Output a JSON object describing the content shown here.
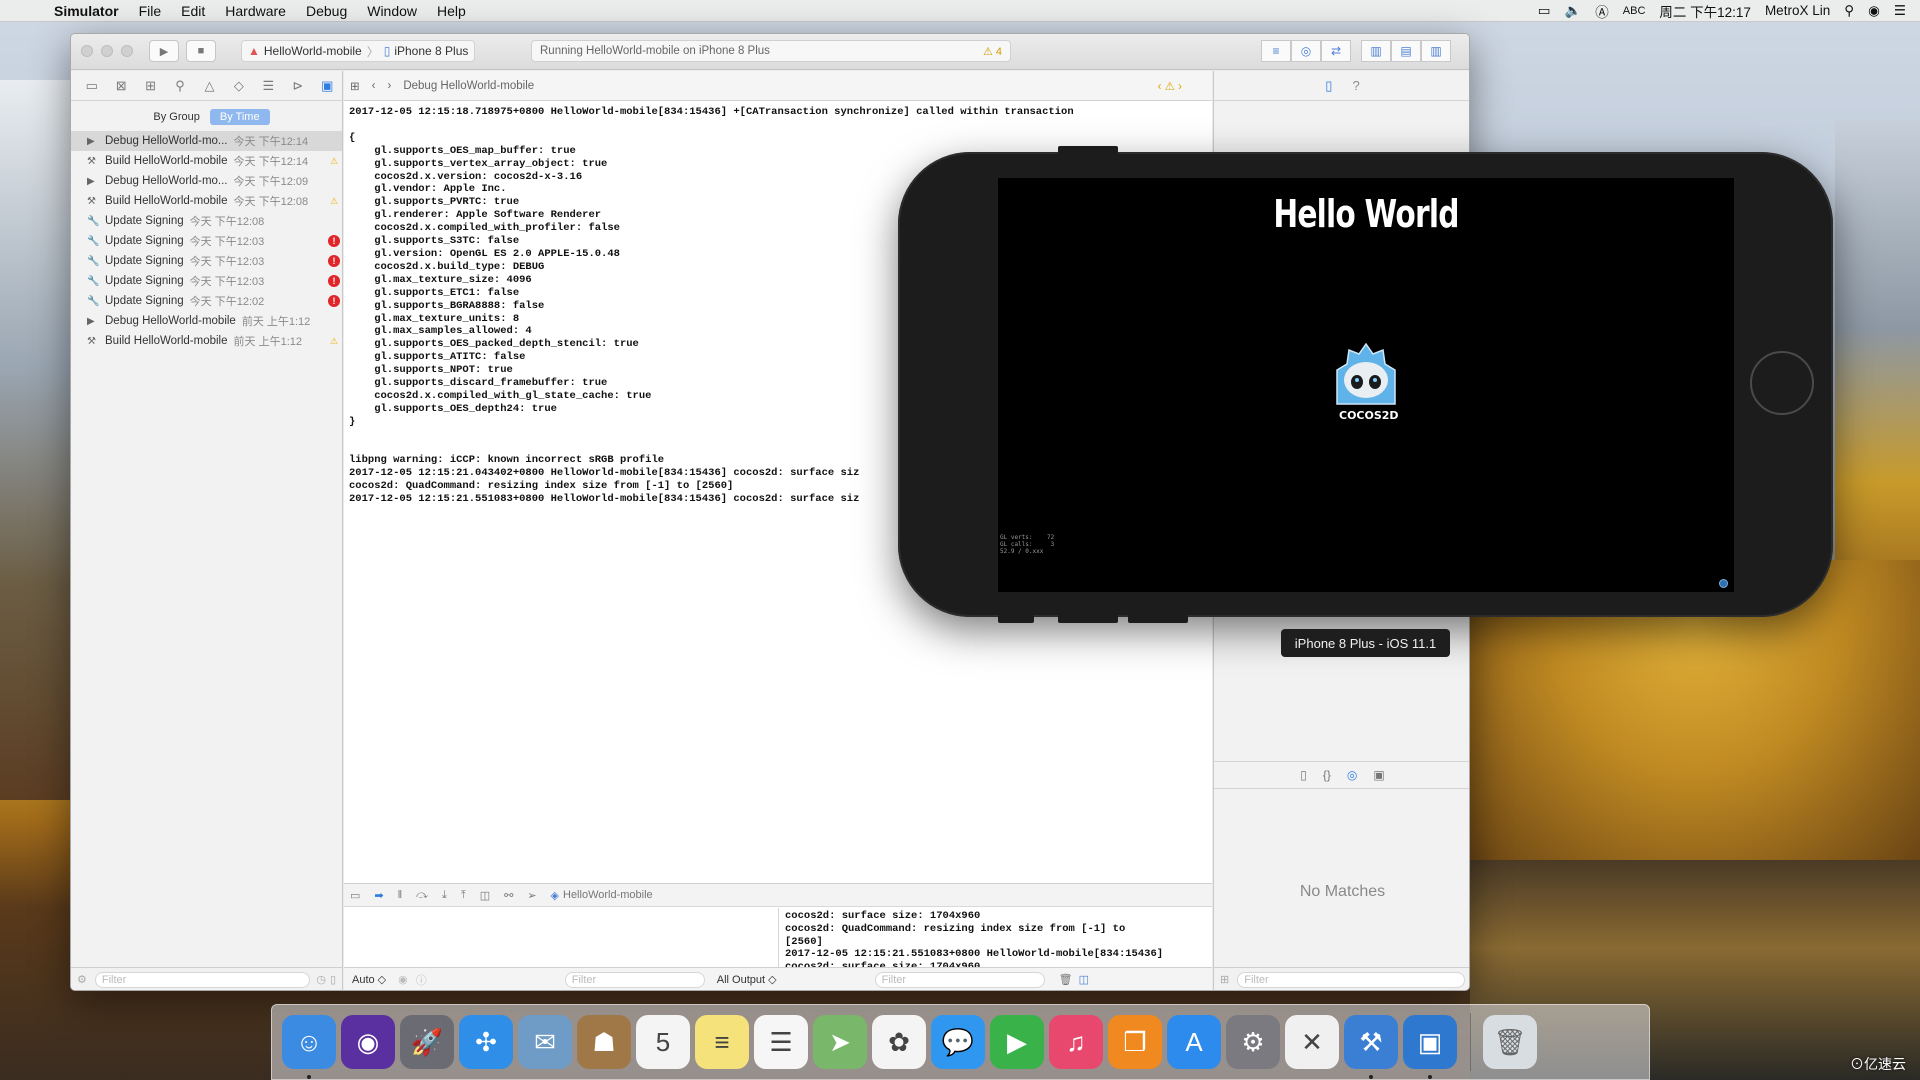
{
  "menubar": {
    "app": "Simulator",
    "items": [
      "File",
      "Edit",
      "Hardware",
      "Debug",
      "Window",
      "Help"
    ],
    "input_source": "ABC",
    "clock": "周二 下午12:17",
    "user": "MetroX Lin"
  },
  "toolbar": {
    "scheme": "HelloWorld-mobile",
    "device": "iPhone 8 Plus",
    "activity": "Running HelloWorld-mobile on iPhone 8 Plus",
    "warning_count": "4"
  },
  "navigator": {
    "group_by": [
      "By Group",
      "By Time"
    ],
    "reports": [
      {
        "label": "Debug HelloWorld-mo...",
        "time": "今天 下午12:14",
        "badge": "",
        "icon": "play-icon"
      },
      {
        "label": "Build HelloWorld-mobile",
        "time": "今天 下午12:14",
        "badge": "warn",
        "icon": "hammer-icon"
      },
      {
        "label": "Debug HelloWorld-mo...",
        "time": "今天 下午12:09",
        "badge": "",
        "icon": "play-icon"
      },
      {
        "label": "Build HelloWorld-mobile",
        "time": "今天 下午12:08",
        "badge": "warn",
        "icon": "hammer-icon"
      },
      {
        "label": "Update Signing",
        "time": "今天 下午12:08",
        "badge": "",
        "icon": "wrench-icon"
      },
      {
        "label": "Update Signing",
        "time": "今天 下午12:03",
        "badge": "err",
        "icon": "wrench-icon"
      },
      {
        "label": "Update Signing",
        "time": "今天 下午12:03",
        "badge": "err",
        "icon": "wrench-icon"
      },
      {
        "label": "Update Signing",
        "time": "今天 下午12:03",
        "badge": "err",
        "icon": "wrench-icon"
      },
      {
        "label": "Update Signing",
        "time": "今天 下午12:02",
        "badge": "err",
        "icon": "wrench-icon"
      },
      {
        "label": "Debug HelloWorld-mobile",
        "time": "前天 上午1:12",
        "badge": "",
        "icon": "play-icon"
      },
      {
        "label": "Build HelloWorld-mobile",
        "time": "前天 上午1:12",
        "badge": "warn",
        "icon": "hammer-icon"
      }
    ],
    "filter_placeholder": "Filter"
  },
  "editor": {
    "jumpbar_title": "Debug HelloWorld-mobile",
    "log_lines": [
      "2017-12-05 12:15:18.718975+0800 HelloWorld-mobile[834:15436] +[CATransaction synchronize] called within transaction",
      "",
      "{",
      "    gl.supports_OES_map_buffer: true",
      "    gl.supports_vertex_array_object: true",
      "    cocos2d.x.version: cocos2d-x-3.16",
      "    gl.vendor: Apple Inc.",
      "    gl.supports_PVRTC: true",
      "    gl.renderer: Apple Software Renderer",
      "    cocos2d.x.compiled_with_profiler: false",
      "    gl.supports_S3TC: false",
      "    gl.version: OpenGL ES 2.0 APPLE-15.0.48",
      "    cocos2d.x.build_type: DEBUG",
      "    gl.max_texture_size: 4096",
      "    gl.supports_ETC1: false",
      "    gl.supports_BGRA8888: false",
      "    gl.max_texture_units: 8",
      "    gl.max_samples_allowed: 4",
      "    gl.supports_OES_packed_depth_stencil: true",
      "    gl.supports_ATITC: false",
      "    gl.supports_NPOT: true",
      "    gl.supports_discard_framebuffer: true",
      "    cocos2d.x.compiled_with_gl_state_cache: true",
      "    gl.supports_OES_depth24: true",
      "}",
      "",
      "",
      "libpng warning: iCCP: known incorrect sRGB profile",
      "2017-12-05 12:15:21.043402+0800 HelloWorld-mobile[834:15436] cocos2d: surface siz",
      "cocos2d: QuadCommand: resizing index size from [-1] to [2560]",
      "2017-12-05 12:15:21.551083+0800 HelloWorld-mobile[834:15436] cocos2d: surface siz"
    ]
  },
  "debug_area": {
    "target": "HelloWorld-mobile",
    "console_lines": [
      "cocos2d: surface size: 1704x960",
      "cocos2d: QuadCommand: resizing index size from [-1] to",
      "[2560]",
      "2017-12-05 12:15:21.551083+0800 HelloWorld-mobile[834:15436]",
      "cocos2d: surface size: 1704x960"
    ],
    "vars_mode": "Auto ◇",
    "output_mode": "All Output ◇",
    "filter_placeholder": "Filter"
  },
  "inspector": {
    "no_matches": "No Matches",
    "filter_placeholder": "Filter"
  },
  "simulator": {
    "title": "Hello World",
    "logo_text": "COCOS2D",
    "device_label": "iPhone 8 Plus - iOS 11.1",
    "stats": "GL verts:    72\nGL calls:     3\n52.9 / 0.xxx"
  },
  "dock": {
    "apps": [
      {
        "name": "finder-icon",
        "color": "#3b8be3",
        "glyph": "☺"
      },
      {
        "name": "siri-icon",
        "color": "#5a2fa0",
        "glyph": "◉"
      },
      {
        "name": "launchpad-icon",
        "color": "#6b6b73",
        "glyph": "🚀"
      },
      {
        "name": "safari-icon",
        "color": "#2e8ee8",
        "glyph": "✣"
      },
      {
        "name": "mail-icon",
        "color": "#6e9cc7",
        "glyph": "✉"
      },
      {
        "name": "contacts-icon",
        "color": "#a07848",
        "glyph": "☗"
      },
      {
        "name": "calendar-icon",
        "color": "#f4f4f4",
        "glyph": "5"
      },
      {
        "name": "notes-icon",
        "color": "#f5e27a",
        "glyph": "≡"
      },
      {
        "name": "reminders-icon",
        "color": "#f6f6f6",
        "glyph": "☰"
      },
      {
        "name": "maps-icon",
        "color": "#79b86b",
        "glyph": "➤"
      },
      {
        "name": "photos-icon",
        "color": "#f4f4f4",
        "glyph": "✿"
      },
      {
        "name": "messages-icon",
        "color": "#2f97f0",
        "glyph": "💬"
      },
      {
        "name": "facetime-icon",
        "color": "#3ab24a",
        "glyph": "▶"
      },
      {
        "name": "itunes-icon",
        "color": "#e8486e",
        "glyph": "♫"
      },
      {
        "name": "ibooks-icon",
        "color": "#f08a20",
        "glyph": "❒"
      },
      {
        "name": "app-store-icon",
        "color": "#2d8bee",
        "glyph": "A"
      },
      {
        "name": "system-preferences-icon",
        "color": "#7a7a80",
        "glyph": "⚙"
      },
      {
        "name": "xmind-icon",
        "color": "#f0f0f0",
        "glyph": "✕"
      },
      {
        "name": "xcode-icon",
        "color": "#3b7fd4",
        "glyph": "⚒"
      },
      {
        "name": "simulator-icon",
        "color": "#2f78d0",
        "glyph": "▣"
      }
    ],
    "trash": {
      "name": "trash-icon",
      "color": "#d8dde2",
      "glyph": "🗑"
    },
    "watermark": "⊙亿速云"
  }
}
